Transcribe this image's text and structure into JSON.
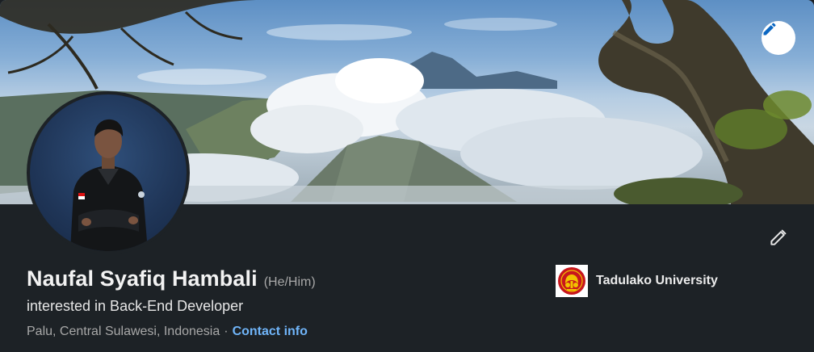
{
  "profile": {
    "name": "Naufal Syafiq Hambali",
    "pronouns": "(He/Him)",
    "headline": "interested in Back-End Developer",
    "location": "Palu, Central Sulawesi, Indonesia",
    "separator": "·",
    "contact_label": "Contact info"
  },
  "education": {
    "name": "Tadulako University"
  },
  "icons": {
    "banner_edit": "pencil-icon",
    "intro_edit": "pencil-icon",
    "school_logo": "tadulako-logo"
  },
  "colors": {
    "card_background": "#1d2226",
    "link": "#70b5f9",
    "muted_text": "#a8a8a8",
    "logo_red": "#c8161d",
    "logo_gold": "#f2c200"
  }
}
